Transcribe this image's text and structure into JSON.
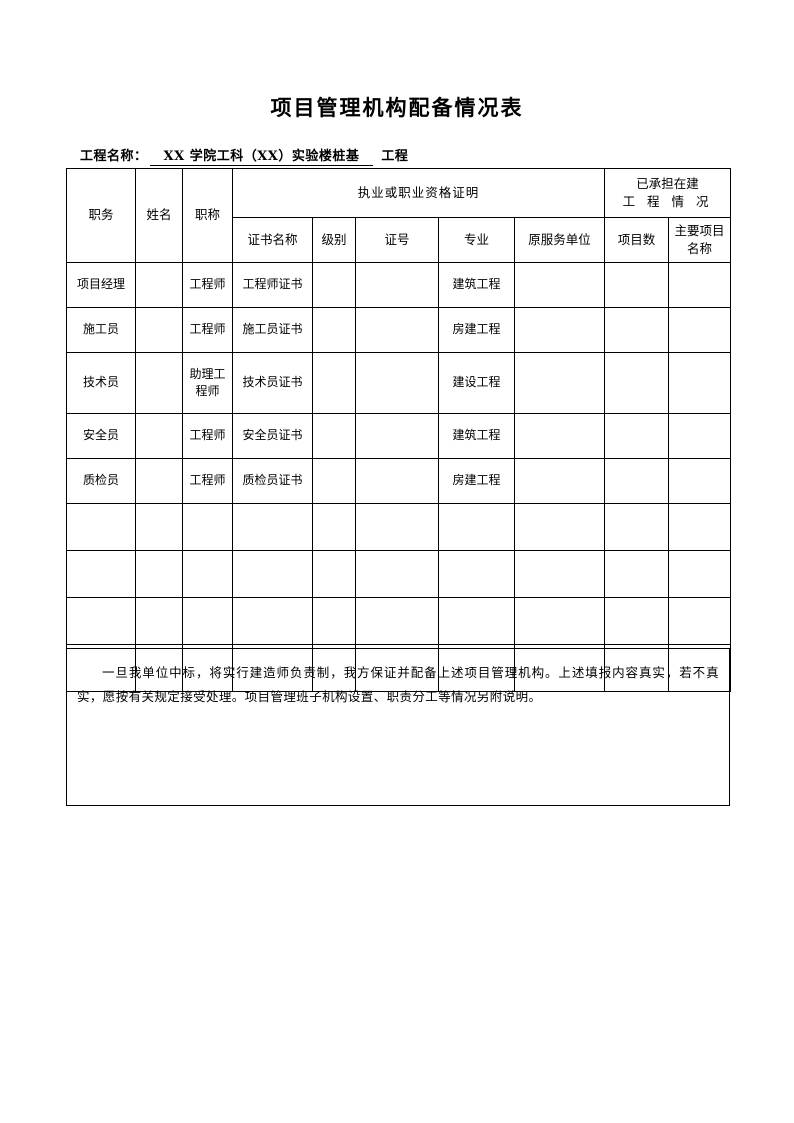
{
  "document": {
    "title": "项目管理机构配备情况表"
  },
  "project": {
    "label": "工程名称：",
    "value": "XX 学院工科（XX）实验楼桩基",
    "suffix": "工程"
  },
  "table": {
    "headers": {
      "position": "职务",
      "name": "姓名",
      "title_rank": "职称",
      "qualification_group": "执业或职业资格证明",
      "undertaken_group_line1": "已承担在建",
      "undertaken_group_line2": "工 程 情 况",
      "cert_name": "证书名称",
      "level": "级别",
      "cert_no": "证号",
      "major": "专业",
      "former_unit": "原服务单位",
      "project_count": "项目数",
      "main_project_name": "主要项目名称"
    },
    "rows": [
      {
        "position": "项目经理",
        "name": "",
        "title_rank": "工程师",
        "cert_name": "工程师证书",
        "level": "",
        "cert_no": "",
        "major": "建筑工程",
        "former_unit": "",
        "project_count": "",
        "main_project_name": ""
      },
      {
        "position": "施工员",
        "name": "",
        "title_rank": "工程师",
        "cert_name": "施工员证书",
        "level": "",
        "cert_no": "",
        "major": "房建工程",
        "former_unit": "",
        "project_count": "",
        "main_project_name": ""
      },
      {
        "position": "技术员",
        "name": "",
        "title_rank": "助理工程师",
        "cert_name": "技术员证书",
        "level": "",
        "cert_no": "",
        "major": "建设工程",
        "former_unit": "",
        "project_count": "",
        "main_project_name": ""
      },
      {
        "position": "安全员",
        "name": "",
        "title_rank": "工程师",
        "cert_name": "安全员证书",
        "level": "",
        "cert_no": "",
        "major": "建筑工程",
        "former_unit": "",
        "project_count": "",
        "main_project_name": ""
      },
      {
        "position": "质检员",
        "name": "",
        "title_rank": "工程师",
        "cert_name": "质检员证书",
        "level": "",
        "cert_no": "",
        "major": "房建工程",
        "former_unit": "",
        "project_count": "",
        "main_project_name": ""
      },
      {
        "position": "",
        "name": "",
        "title_rank": "",
        "cert_name": "",
        "level": "",
        "cert_no": "",
        "major": "",
        "former_unit": "",
        "project_count": "",
        "main_project_name": ""
      },
      {
        "position": "",
        "name": "",
        "title_rank": "",
        "cert_name": "",
        "level": "",
        "cert_no": "",
        "major": "",
        "former_unit": "",
        "project_count": "",
        "main_project_name": ""
      },
      {
        "position": "",
        "name": "",
        "title_rank": "",
        "cert_name": "",
        "level": "",
        "cert_no": "",
        "major": "",
        "former_unit": "",
        "project_count": "",
        "main_project_name": ""
      },
      {
        "position": "",
        "name": "",
        "title_rank": "",
        "cert_name": "",
        "level": "",
        "cert_no": "",
        "major": "",
        "former_unit": "",
        "project_count": "",
        "main_project_name": ""
      }
    ]
  },
  "note": {
    "text": "一旦我单位中标，将实行建造师负责制，我方保证并配备上述项目管理机构。上述填报内容真实，若不真实，愿按有关规定接受处理。项目管理班子机构设置、职责分工等情况另附说明。"
  }
}
